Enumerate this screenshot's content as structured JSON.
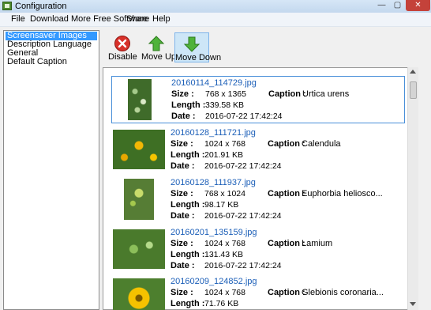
{
  "window": {
    "title": "Configuration",
    "minimize": "—",
    "maximize": "▢",
    "close": "✕"
  },
  "menu": [
    "File",
    "Download More Free Software",
    "Share",
    "Help"
  ],
  "sidebar": {
    "items": [
      {
        "label": "Screensaver Images",
        "selected": true
      },
      {
        "label": "Description Language",
        "selected": false
      },
      {
        "label": "General",
        "selected": false
      },
      {
        "label": "Default Caption",
        "selected": false
      }
    ]
  },
  "toolbar": {
    "disable": {
      "label": "Disable",
      "icon": "disable-icon"
    },
    "move_up": {
      "label": "Move Up",
      "icon": "arrow-up-icon"
    },
    "move_down": {
      "label": "Move Down",
      "icon": "arrow-down-icon",
      "active": true
    }
  },
  "fields": {
    "size": "Size :",
    "length": "Length :",
    "date": "Date :",
    "caption": "Caption :"
  },
  "images": [
    {
      "filename": "20160114_114729.jpg",
      "size": "768 x 1365",
      "length": "339.58 KB",
      "date": "2016-07-22 17:42:24",
      "caption": "Urtica urens",
      "orientation": "portrait",
      "selected": true
    },
    {
      "filename": "20160128_111721.jpg",
      "size": "1024 x 768",
      "length": "201.91 KB",
      "date": "2016-07-22 17:42:24",
      "caption": "Calendula",
      "orientation": "landscape",
      "selected": false
    },
    {
      "filename": "20160128_111937.jpg",
      "size": "768 x 1024",
      "length": "98.17 KB",
      "date": "2016-07-22 17:42:24",
      "caption": "Euphorbia helioscо...",
      "orientation": "portrait",
      "selected": false
    },
    {
      "filename": "20160201_135159.jpg",
      "size": "1024 x 768",
      "length": "131.43 KB",
      "date": "2016-07-22 17:42:24",
      "caption": "Lamium",
      "orientation": "landscape",
      "selected": false
    },
    {
      "filename": "20160209_124852.jpg",
      "size": "1024 x 768",
      "length": "71.76 KB",
      "date": "",
      "caption": "Glebionis coronaria...",
      "orientation": "landscape",
      "selected": false
    }
  ]
}
